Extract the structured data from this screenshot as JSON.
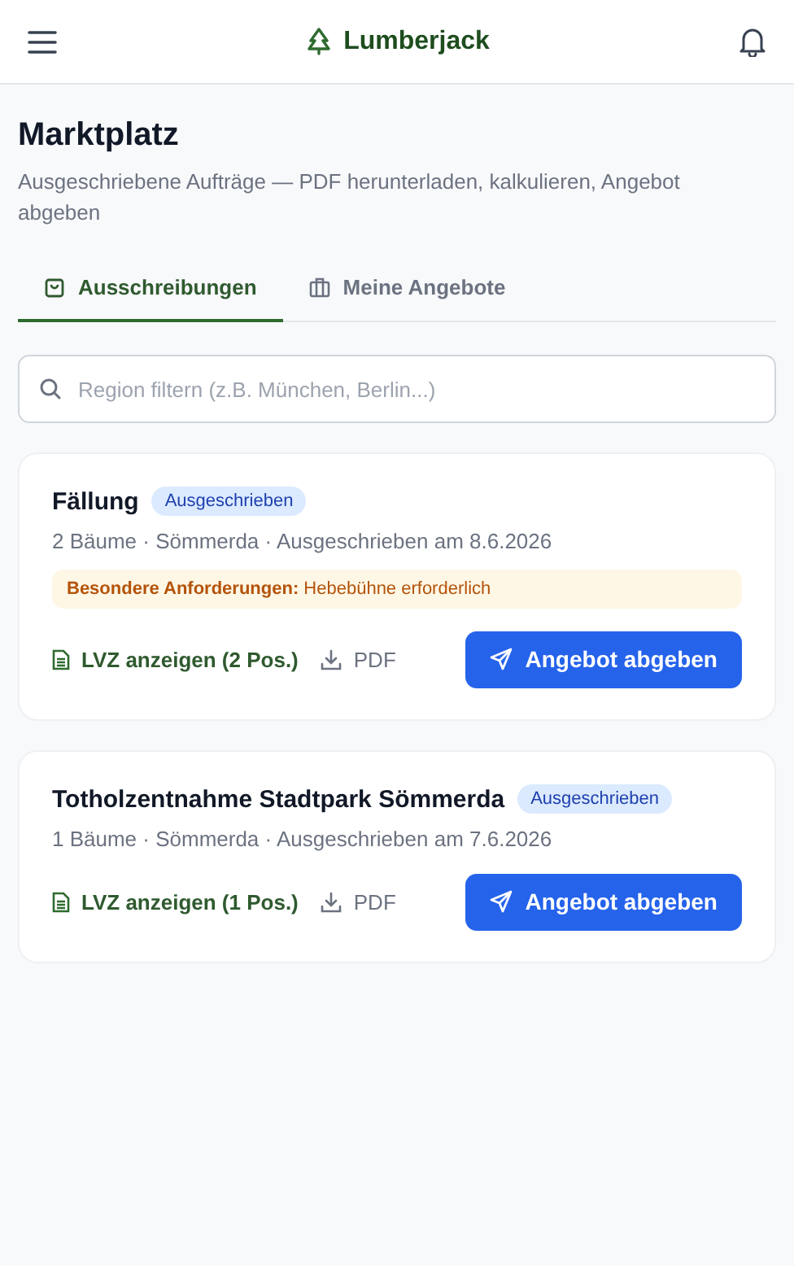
{
  "header": {
    "title": "Lumberjack"
  },
  "page": {
    "title": "Marktplatz",
    "subtitle": "Ausgeschriebene Aufträge — PDF herunterladen, kalkulieren, Angebot abgeben"
  },
  "tabs": [
    {
      "label": "Ausschreibungen",
      "selected": true,
      "kind": "bag"
    },
    {
      "label": "Meine Angebote",
      "selected": false,
      "kind": "briefcase"
    }
  ],
  "search": {
    "placeholder": "Region filtern (z.B. München, Berlin...)"
  },
  "tenders": [
    {
      "title": "Fällung",
      "status": "Ausgeschrieben",
      "meta": "2 Bäume · Sömmerda · Ausgeschrieben am 8.6.2026",
      "requirements": "**Besondere Anforderungen:** Hebebühne erforderlich",
      "lvz": "LVZ anzeigen (2 Pos.)",
      "pdf": "PDF",
      "action": "Angebot abgeben"
    },
    {
      "title": "Totholzentnahme Stadtpark Sömmerda",
      "status": "Ausgeschrieben",
      "meta": "1 Bäume · Sömmerda · Ausgeschrieben am 7.6.2026",
      "lvz": "LVZ anzeigen (1 Pos.)",
      "pdf": "PDF",
      "action": "Angebot abgeben"
    }
  ]
}
